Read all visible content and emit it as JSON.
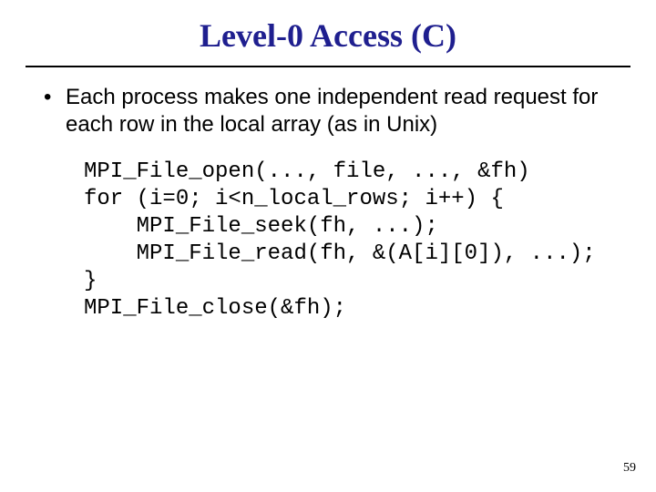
{
  "title": "Level-0 Access (C)",
  "bullet": {
    "marker": "•",
    "text": "Each process makes one independent read request for each row in the local array (as in Unix)"
  },
  "code": {
    "l1": "MPI_File_open(..., file, ..., &fh)",
    "l2": "for (i=0; i<n_local_rows; i++) {",
    "l3": "    MPI_File_seek(fh, ...);",
    "l4": "    MPI_File_read(fh, &(A[i][0]), ...);",
    "l5": "}",
    "l6": "MPI_File_close(&fh);"
  },
  "page_number": "59"
}
